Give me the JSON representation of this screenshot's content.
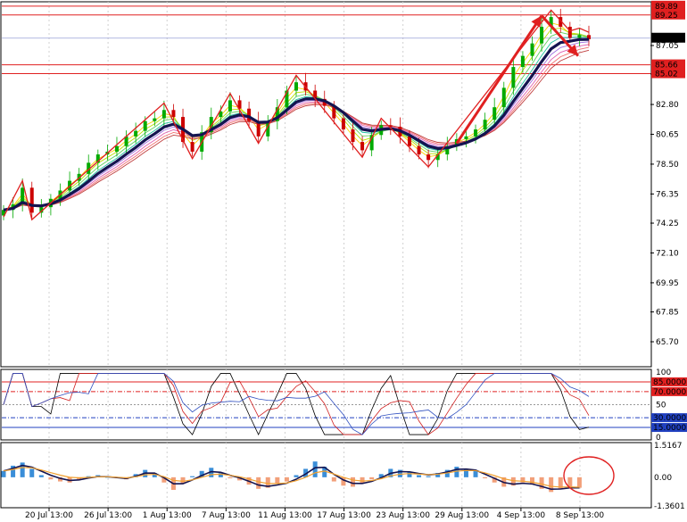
{
  "chart_data": {
    "type": "candlestick",
    "price_panel": {
      "y_ticks": [
        "87.05",
        "85.00",
        "82.80",
        "80.65",
        "78.50",
        "76.35",
        "74.25",
        "72.10",
        "69.95",
        "67.85",
        "65.70"
      ],
      "current_price": "87.58",
      "horizontal_levels": [
        {
          "label": "89.89",
          "value": 89.89
        },
        {
          "label": "89.25",
          "value": 89.25
        },
        {
          "label": "85.66",
          "value": 85.66
        },
        {
          "label": "85.02",
          "value": 85.02
        }
      ],
      "ylim": [
        63.9,
        90.2
      ],
      "close_series": [
        75.2,
        75.6,
        76.8,
        75.0,
        75.4,
        76.0,
        76.6,
        77.3,
        77.8,
        78.6,
        79.2,
        79.4,
        79.8,
        80.5,
        80.9,
        81.6,
        81.8,
        82.4,
        81.9,
        80.1,
        79.4,
        80.8,
        81.9,
        82.3,
        83.1,
        82.5,
        81.6,
        80.5,
        81.6,
        82.6,
        83.8,
        84.4,
        83.8,
        83.2,
        82.7,
        81.8,
        81.0,
        80.1,
        79.5,
        80.6,
        81.3,
        81.2,
        80.5,
        79.8,
        79.2,
        78.8,
        79.2,
        79.8,
        80.3,
        80.5,
        81.0,
        81.7,
        82.6,
        84.0,
        85.5,
        86.3,
        87.2,
        88.4,
        89.1,
        88.4,
        87.6,
        87.8,
        87.5
      ]
    },
    "rsi_panel": {
      "y_ticks": [
        "100",
        "50",
        "0"
      ],
      "levels": [
        {
          "label": "85.0000",
          "value": 85
        },
        {
          "label": "70.0000",
          "value": 70
        },
        {
          "label": "30.0000",
          "value": 30
        },
        {
          "label": "15.0000",
          "value": 15
        }
      ]
    },
    "macd_panel": {
      "y_ticks": [
        "1.5167",
        "0.00",
        "-1.3601"
      ],
      "ylim": [
        -1.45,
        1.65
      ],
      "histogram": [
        0.3,
        0.55,
        0.7,
        0.4,
        0.1,
        -0.1,
        -0.2,
        -0.25,
        -0.1,
        0.05,
        0.1,
        0.02,
        -0.05,
        -0.1,
        0.15,
        0.35,
        0.2,
        -0.25,
        -0.6,
        -0.3,
        0.05,
        0.3,
        0.45,
        0.2,
        -0.05,
        -0.15,
        -0.35,
        -0.55,
        -0.5,
        -0.3,
        -0.2,
        0.1,
        0.4,
        0.75,
        0.5,
        -0.2,
        -0.4,
        -0.45,
        -0.3,
        -0.1,
        0.15,
        0.4,
        0.35,
        0.25,
        0.1,
        0.05,
        0.2,
        0.35,
        0.5,
        0.4,
        0.3,
        -0.05,
        -0.25,
        -0.45,
        -0.4,
        -0.25,
        -0.35,
        -0.55,
        -0.7,
        -0.55,
        -0.45,
        -0.5
      ]
    },
    "x_ticks": [
      "20 Jul 13:00",
      "26 Jul 13:00",
      "1 Aug 13:00",
      "7 Aug 13:00",
      "11 Aug 13:00",
      "17 Aug 13:00",
      "23 Aug 13:00",
      "29 Aug 13:00",
      "4 Sep 13:00",
      "8 Sep 13:00"
    ],
    "colors": {
      "up": "#00aa00",
      "down": "#cc0000",
      "zigzag": "#e02020",
      "ma_main": "#141450",
      "hist_pos": "#3a8ed8",
      "hist_neg": "#f2a07a",
      "level_red": "#e02020",
      "level_blue": "#2040c0",
      "annotation": "#e02020"
    }
  }
}
